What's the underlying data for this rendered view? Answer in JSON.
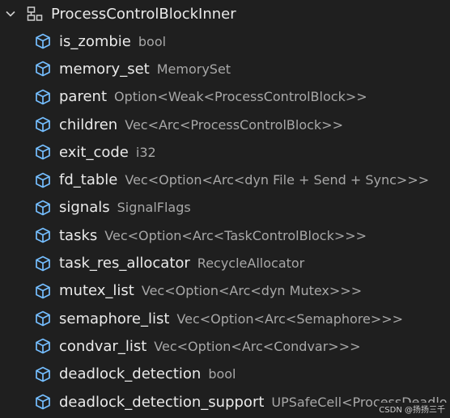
{
  "struct": {
    "name": "ProcessControlBlockInner",
    "icon": "struct-icon",
    "expanded": true
  },
  "fields": [
    {
      "name": "is_zombie",
      "type": "bool"
    },
    {
      "name": "memory_set",
      "type": "MemorySet"
    },
    {
      "name": "parent",
      "type": "Option<Weak<ProcessControlBlock>>"
    },
    {
      "name": "children",
      "type": "Vec<Arc<ProcessControlBlock>>"
    },
    {
      "name": "exit_code",
      "type": "i32"
    },
    {
      "name": "fd_table",
      "type": "Vec<Option<Arc<dyn File + Send + Sync>>>"
    },
    {
      "name": "signals",
      "type": "SignalFlags"
    },
    {
      "name": "tasks",
      "type": "Vec<Option<Arc<TaskControlBlock>>>"
    },
    {
      "name": "task_res_allocator",
      "type": "RecycleAllocator"
    },
    {
      "name": "mutex_list",
      "type": "Vec<Option<Arc<dyn Mutex>>>"
    },
    {
      "name": "semaphore_list",
      "type": "Vec<Option<Arc<Semaphore>>>"
    },
    {
      "name": "condvar_list",
      "type": "Vec<Option<Arc<Condvar>>>"
    },
    {
      "name": "deadlock_detection",
      "type": "bool"
    },
    {
      "name": "deadlock_detection_support",
      "type": "UPSafeCell<ProcessDeadlo"
    }
  ],
  "field_icon": "field-cube-icon",
  "colors": {
    "background": "#1f1f1f",
    "field_icon": "#75beff",
    "text": "#eaeaea",
    "type_text": "#a8a8a8"
  },
  "watermark": "CSDN @扬扬三千"
}
